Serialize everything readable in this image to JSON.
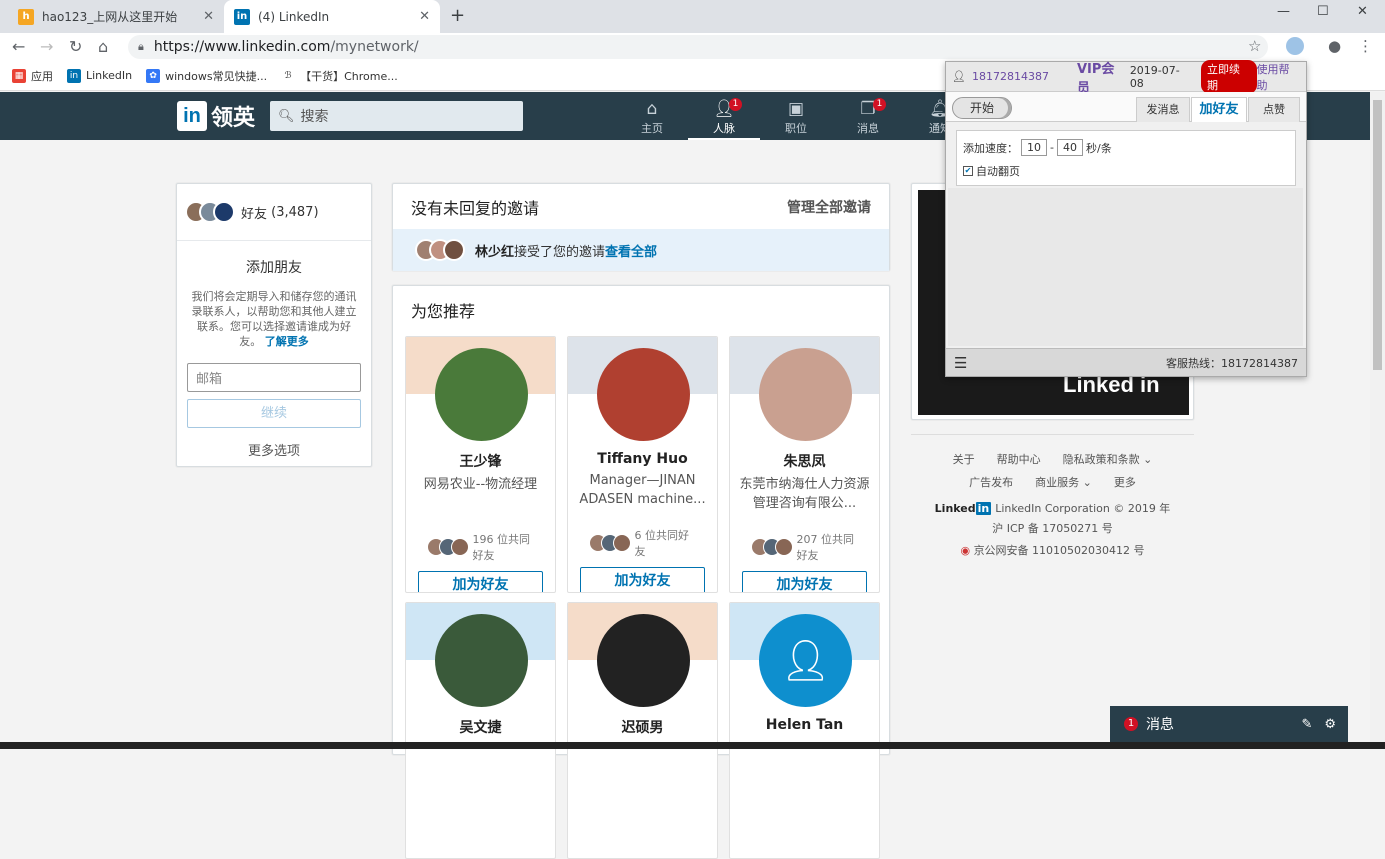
{
  "browser": {
    "tabs": [
      {
        "title": "hao123_上网从这里开始",
        "close": "✕"
      },
      {
        "title": "(4) LinkedIn",
        "close": "✕"
      }
    ],
    "new_tab": "+",
    "url_host": "https://www.linkedin.com",
    "url_path": "/mynetwork/",
    "bookmarks": [
      "应用",
      "LinkedIn",
      "windows常见快捷...",
      "【干货】Chrome..."
    ]
  },
  "header": {
    "logo_text": "领英",
    "search_placeholder": "搜索",
    "nav": [
      {
        "label": "主页",
        "icon": "home-icon",
        "badge": ""
      },
      {
        "label": "人脉",
        "icon": "people-icon",
        "badge": "1"
      },
      {
        "label": "职位",
        "icon": "briefcase-icon",
        "badge": ""
      },
      {
        "label": "消息",
        "icon": "messages-icon",
        "badge": "1"
      },
      {
        "label": "通知",
        "icon": "bell-icon",
        "badge": ""
      }
    ]
  },
  "left": {
    "friends_label": "好友",
    "friends_count": "(3,487)",
    "add_title": "添加朋友",
    "add_desc": "我们将会定期导入和储存您的通讯录联系人，以帮助您和其他人建立联系。您可以选择邀请谁成为好友。",
    "learn_more": "了解更多",
    "email_placeholder": "邮箱",
    "continue_label": "继续",
    "more_options": "更多选项"
  },
  "invitations": {
    "title": "没有未回复的邀请",
    "manage": "管理全部邀请",
    "accepted_name": "林少红",
    "accepted_text": "接受了您的邀请",
    "see_all": "查看全部"
  },
  "recommend": {
    "title": "为您推荐",
    "add_label": "加为好友",
    "people": [
      {
        "name": "王少锋",
        "headline": "网易农业--物流经理",
        "mutual": "196 位共同好友",
        "bg": "#f5dcc9",
        "pic": "#4a7a3a"
      },
      {
        "name": "Tiffany Huo",
        "headline": "Manager—JINAN ADASEN machine...",
        "mutual": "6 位共同好友",
        "bg": "#dde3ea",
        "pic": "#b04030"
      },
      {
        "name": "朱思凤",
        "headline": "东莞市纳海仕人力资源管理咨询有限公...",
        "mutual": "207 位共同好友",
        "bg": "#dde3ea",
        "pic": "#c9a090"
      },
      {
        "name": "吴文捷",
        "headline": "",
        "mutual": "",
        "bg": "#cfe6f5",
        "pic": "#3a5a3a"
      },
      {
        "name": "迟硕男",
        "headline": "",
        "mutual": "",
        "bg": "#f5dcc9",
        "pic": "#222222"
      },
      {
        "name": "Helen Tan",
        "headline": "",
        "mutual": "",
        "bg": "#cfe6f5",
        "pic": "#0e8fce"
      }
    ]
  },
  "ad": {
    "brand": "Linked in"
  },
  "footer": {
    "links_row1": [
      "关于",
      "帮助中心",
      "隐私政策和条款 ⌄"
    ],
    "links_row2": [
      "广告发布",
      "商业服务 ⌄",
      "更多"
    ],
    "copyright": "LinkedIn Corporation © 2019 年",
    "icp": "沪 ICP 备 17050271 号",
    "police": "京公网安备 11010502030412 号"
  },
  "messaging": {
    "label": "消息",
    "badge": "1"
  },
  "extension": {
    "user_id": "18172814387",
    "vip": "VIP会员",
    "date": "2019-07-08",
    "renew": "立即续期",
    "help": "使用帮助",
    "start": "开始",
    "tabs": [
      "发消息",
      "加好友",
      "点赞"
    ],
    "speed_label": "添加速度：",
    "speed_min": "10",
    "speed_max": "40",
    "speed_unit": "秒/条",
    "auto_page": "自动翻页",
    "hotline": "客服热线：18172814387"
  }
}
